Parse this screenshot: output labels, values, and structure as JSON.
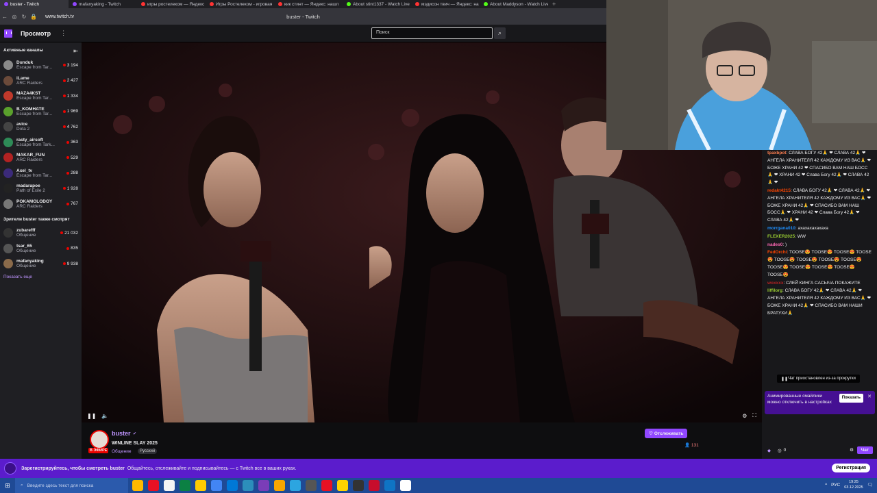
{
  "browser": {
    "tabs": [
      {
        "label": "buster - Twitch",
        "color": "#9147ff"
      },
      {
        "label": "mafanyaking - Twitch",
        "color": "#9147ff"
      },
      {
        "label": "игры ростелеком — Яндекс",
        "color": "#f33"
      },
      {
        "label": "Игры Ростелеком - игровая",
        "color": "#f33"
      },
      {
        "label": "кик стинт — Яндекс: нашл",
        "color": "#f33"
      },
      {
        "label": "About stint1337 - Watch Live",
        "color": "#53fc18"
      },
      {
        "label": "мэдисон твич — Яндекс: на",
        "color": "#f33"
      },
      {
        "label": "About Maddyson - Watch Live",
        "color": "#53fc18"
      }
    ],
    "url": "www.twitch.tv",
    "page_title": "buster - Twitch"
  },
  "topbar": {
    "browse": "Просмотр",
    "search_placeholder": "Поиск"
  },
  "sidebar": {
    "active_header": "Активные каналы",
    "channels": [
      {
        "name": "Dunduk",
        "game": "Escape from Tar...",
        "viewers": "3 194",
        "color": "#8a8a8a"
      },
      {
        "name": "iLame",
        "game": "ARC Raiders",
        "viewers": "2 427",
        "color": "#6b4a3a"
      },
      {
        "name": "MAZA4KST",
        "game": "Escape from Tar...",
        "viewers": "1 334",
        "color": "#c0392b"
      },
      {
        "name": "B_KOMHATE",
        "game": "Escape from Tar...",
        "viewers": "1 969",
        "color": "#5aa02c"
      },
      {
        "name": "avice",
        "game": "Dota 2",
        "viewers": "4 762",
        "color": "#444"
      },
      {
        "name": "rasty_airsoft",
        "game": "Escape from Tark...",
        "viewers": "363",
        "color": "#2e8b57"
      },
      {
        "name": "MAKAR_FUN",
        "game": "ARC Raiders",
        "viewers": "529",
        "color": "#b22222"
      },
      {
        "name": "Axel_tv",
        "game": "Escape from Tar...",
        "viewers": "288",
        "color": "#3b2a7a"
      },
      {
        "name": "madarapoe",
        "game": "Path of Exile 2",
        "viewers": "1 928",
        "color": "#222"
      },
      {
        "name": "POKAMOLODOY",
        "game": "ARC Raiders",
        "viewers": "767",
        "color": "#777"
      }
    ],
    "also_header": "Зрители buster также смотрят",
    "also": [
      {
        "name": "zubarefff",
        "game": "Общение",
        "viewers": "21 032",
        "color": "#333"
      },
      {
        "name": "tsar_65",
        "game": "Общение",
        "viewers": "835",
        "color": "#555"
      },
      {
        "name": "mafanyaking",
        "game": "Общение",
        "viewers": "9 938",
        "color": "#8a6a4a"
      }
    ],
    "show_more": "Показать еще"
  },
  "stream": {
    "streamer": "buster",
    "title": "WINLINE SLAY 2025",
    "category": "Общение",
    "language": "Русский",
    "live_badge": "В ЭФИРЕ",
    "follow": "Отслеживать",
    "viewers": "131"
  },
  "chat": {
    "messages": [
      {
        "user": "tpaxbpot",
        "color": "#ff7f50",
        "text": "СЛАВА БОГУ 42🙏 ❤ СЛАВА 42🙏 ❤ АНГЕЛА ХРАНИТЕЛЯ 42 КАЖДОМУ ИЗ ВАС🙏 ❤ БОЖЕ ХРАНИ 42 ❤ СПАСИБО ВАМ НАШ БОСС🙏 ❤ ХРАНИ 42 ❤ Слава Богу 42🙏 ❤ СЛАВА 42🙏 ❤"
      },
      {
        "user": "redakt4215",
        "color": "#ff4500",
        "text": "СЛАВА БОГУ 42🙏 ❤ СЛАВА 42🙏 ❤ АНГЕЛА ХРАНИТЕЛЯ 42 КАЖДОМУ ИЗ ВАС🙏 ❤ БОЖЕ ХРАНИ 42🙏 ❤ СПАСИБО ВАМ НАШ БОСС🙏 ❤ ХРАНИ 42 ❤ Слава Богу 42🙏 ❤ СЛАВА 42🙏 ❤"
      },
      {
        "user": "morrgana010",
        "color": "#1e90ff",
        "text": "ахахахахахаха"
      },
      {
        "user": "FLEXER2025",
        "color": "#9acd32",
        "text": "WW"
      },
      {
        "user": "nades0",
        "color": "#ff69b4",
        "text": ")"
      },
      {
        "user": "FedOrchi",
        "color": "#ff4500",
        "text": "TOOSE😍 TOOSE😍 TOOSE😍 TOOSE😍 TOOSE😍 TOOSE😍 TOOSE😍 TOOSE😍 TOOSE😍 TOOSE😍 TOOSE😍 TOOSE😍 TOOSE😍"
      },
      {
        "user": "woxxxx",
        "color": "#b22222",
        "text": "СЛЕЙ КИНГА САСЫЧА ПОКАЖИТЕ"
      },
      {
        "user": "liffilorg",
        "color": "#9acd32",
        "text": "СЛАВА БОГУ 42🙏 ❤ СЛАВА 42🙏 ❤ АНГЕЛА ХРАНИТЕЛЯ 42 КАЖДОМУ ИЗ ВАС🙏 ❤ БОЖЕ ХРАНИ 42🙏 ❤ СПАСИБО ВАМ НАШИ БРАТУХИ🙏"
      }
    ],
    "paused": "Чат приостановлен из-за прокрутки",
    "notice": "Анимированные смайлики можно отключить в настройках",
    "notice_show": "Показать",
    "points": "0",
    "chat_button": "Чат"
  },
  "banner": {
    "strong": "Зарегистрируйтесь, чтобы смотреть buster",
    "text": "Общайтесь, отслеживайте и подписывайтесь — с Twitch все в ваших руках.",
    "button": "Регистрация"
  },
  "taskbar": {
    "search": "Введите здесь текст для поиска",
    "lang": "РУС",
    "time": "19:25",
    "date": "03.12.2025",
    "icons": [
      "#ffb900",
      "#e81123",
      "#f4f4f4",
      "#0b8043",
      "#ffcc00",
      "#4285f4",
      "#0078d7",
      "#2c8ebb",
      "#7a3db8",
      "#f7a600",
      "#2ca5e0",
      "#555",
      "#e81123",
      "#ffd400",
      "#333",
      "#c70d2c",
      "#0f74c4",
      "#fff"
    ]
  }
}
